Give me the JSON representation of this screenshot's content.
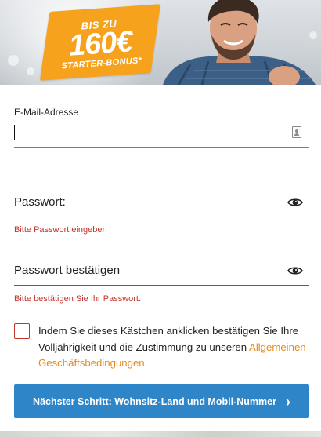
{
  "banner": {
    "badge_line1": "BIS ZU",
    "badge_line2": "160€",
    "badge_line3": "STARTER-BONUS*",
    "badge_color": "#f6a21d"
  },
  "email": {
    "label": "E-Mail-Adresse",
    "value": "",
    "icon": "contact-card-icon"
  },
  "password": {
    "label": "Passwort:",
    "error": "Bitte Passwort eingeben",
    "icon": "eye-icon"
  },
  "password_confirm": {
    "label": "Passwort bestätigen",
    "error": "Bitte bestätigen Sie Ihr Passwort.",
    "icon": "eye-icon"
  },
  "consent": {
    "checked": false,
    "text": "Indem Sie dieses Kästchen anklicken bestätigen Sie Ihre Volljährigkeit und die Zustimmung zu unseren",
    "link_text": "Allgemeinen Geschäftsbedingungen",
    "suffix": "."
  },
  "next_button": {
    "label": "Nächster Schritt: Wohnsitz-Land und Mobil-Nummer",
    "icon": "chevron-right-icon"
  },
  "colors": {
    "accent_blue": "#2e86c8",
    "error_red": "#c3342c",
    "valid_green": "#3aa45b",
    "link_orange": "#e88a1a"
  }
}
